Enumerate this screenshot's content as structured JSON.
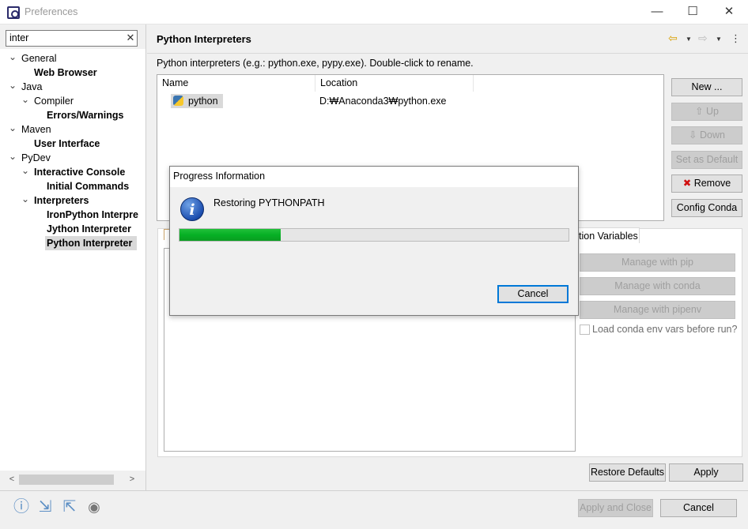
{
  "window": {
    "title": "Preferences",
    "minimize": "—",
    "maximize": "☐",
    "close": "✕"
  },
  "filter": {
    "value": "inter",
    "clear": "✕"
  },
  "tree": [
    {
      "label": "General",
      "bold": false,
      "toggle": "v"
    },
    {
      "label": "Web Browser",
      "bold": true,
      "toggle": ""
    },
    {
      "label": "Java",
      "bold": false,
      "toggle": "v"
    },
    {
      "label": "Compiler",
      "bold": false,
      "toggle": "v"
    },
    {
      "label": "Errors/Warnings",
      "bold": true,
      "toggle": ""
    },
    {
      "label": "Maven",
      "bold": false,
      "toggle": "v"
    },
    {
      "label": "User Interface",
      "bold": true,
      "toggle": ""
    },
    {
      "label": "PyDev",
      "bold": false,
      "toggle": "v"
    },
    {
      "label": "Interactive Console",
      "bold": true,
      "toggle": "v"
    },
    {
      "label": "Initial Commands",
      "bold": true,
      "toggle": ""
    },
    {
      "label": "Interpreters",
      "bold": true,
      "toggle": "v"
    },
    {
      "label": "IronPython Interpre",
      "bold": true,
      "toggle": ""
    },
    {
      "label": "Jython Interpreter",
      "bold": true,
      "toggle": ""
    },
    {
      "label": "Python Interpreter",
      "bold": true,
      "toggle": "",
      "selected": true
    }
  ],
  "page": {
    "title": "Python Interpreters",
    "description": "Python interpreters (e.g.: python.exe, pypy.exe).   Double-click to rename.",
    "table": {
      "columns": [
        "Name",
        "Location"
      ],
      "rows": [
        {
          "name": "python",
          "location": "D:₩Anaconda3₩python.exe"
        }
      ]
    },
    "buttons": {
      "new": "New ...",
      "up": "Up",
      "down": "Down",
      "set_default": "Set as Default",
      "remove": "Remove",
      "config_conda": "Config Conda"
    },
    "env_tab_label": "tion Variables",
    "side_buttons": {
      "pip": "Manage with pip",
      "conda": "Manage with conda",
      "pipenv": "Manage with pipenv"
    },
    "checkbox_label": "Load conda env vars before run?",
    "restore_defaults": "Restore Defaults",
    "apply": "Apply"
  },
  "footer": {
    "apply_close": "Apply and Close",
    "cancel": "Cancel"
  },
  "dialog": {
    "title": "Progress Information",
    "message": "Restoring PYTHONPATH",
    "progress": 0.26,
    "cancel": "Cancel",
    "progress_color": "#06b025"
  },
  "icons": {
    "help": "help-icon",
    "import": "import-icon",
    "export": "export-icon",
    "record": "record-icon",
    "info": "info-icon",
    "remove": "red-x-icon"
  }
}
